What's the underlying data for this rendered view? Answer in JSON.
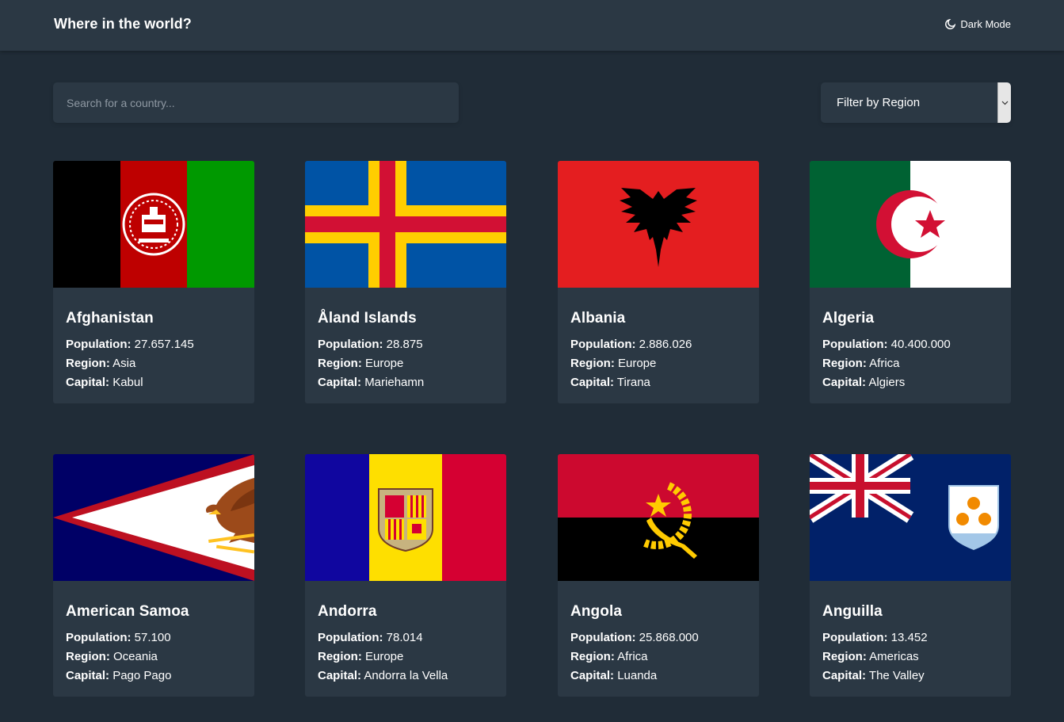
{
  "header": {
    "title": "Where in the world?",
    "theme_toggle_label": "Dark Mode",
    "theme_icon": "moon-icon"
  },
  "search": {
    "placeholder": "Search for a country...",
    "value": "",
    "icon": "search-icon"
  },
  "filter": {
    "label": "Filter by Region",
    "icon": "chevron-down-icon"
  },
  "field_labels": {
    "population": "Population:",
    "region": "Region:",
    "capital": "Capital:"
  },
  "countries": [
    {
      "name": "Afghanistan",
      "population": "27.657.145",
      "region": "Asia",
      "capital": "Kabul"
    },
    {
      "name": "Åland Islands",
      "population": "28.875",
      "region": "Europe",
      "capital": "Mariehamn"
    },
    {
      "name": "Albania",
      "population": "2.886.026",
      "region": "Europe",
      "capital": "Tirana"
    },
    {
      "name": "Algeria",
      "population": "40.400.000",
      "region": "Africa",
      "capital": "Algiers"
    },
    {
      "name": "American Samoa",
      "population": "57.100",
      "region": "Oceania",
      "capital": "Pago Pago"
    },
    {
      "name": "Andorra",
      "population": "78.014",
      "region": "Europe",
      "capital": "Andorra la Vella"
    },
    {
      "name": "Angola",
      "population": "25.868.000",
      "region": "Africa",
      "capital": "Luanda"
    },
    {
      "name": "Anguilla",
      "population": "13.452",
      "region": "Americas",
      "capital": "The Valley"
    }
  ],
  "colors": {
    "background": "#202c37",
    "surface": "#2b3844",
    "text": "#ffffff",
    "placeholder": "#8f99a3"
  }
}
